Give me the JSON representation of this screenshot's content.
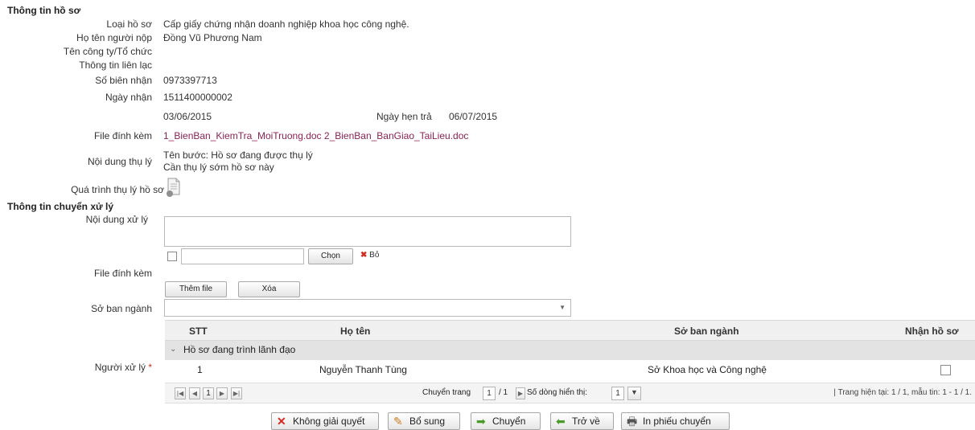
{
  "ho_so": {
    "section_title": "Thông tin hồ sơ",
    "loai_ho_so_label": "Loại hồ sơ",
    "loai_ho_so_value": "Cấp giấy chứng nhận doanh nghiệp khoa học công nghệ.",
    "ho_ten_label": "Họ tên người nộp",
    "ho_ten_value": "Đồng Vũ Phương Nam",
    "cong_ty_label": "Tên công ty/Tổ chức",
    "lien_lac_label": "Thông tin liên lạc",
    "lien_lac_value": "0973397713",
    "bien_nhan_label": "Số biên nhận",
    "bien_nhan_value": "1511400000002",
    "ngay_nhan_label": "Ngày nhận",
    "ngay_nhan_value": "03/06/2015",
    "ngay_hen_tra_label": "Ngày hẹn trả",
    "ngay_hen_tra_value": "06/07/2015",
    "file_label": "File đính kèm",
    "file_1": "1_BienBan_KiemTra_MoiTruong.doc",
    "file_2": "2_BienBan_BanGiao_TaiLieu.doc",
    "noi_dung_label": "Nội dung thụ lý",
    "noi_dung_line1": "Tên bước: Hồ sơ đang được thụ lý",
    "noi_dung_line2": "Cần thụ lý sớm hồ sơ này",
    "qua_trinh_label": "Quá trình thụ lý hồ sơ"
  },
  "chuyen_xu_ly": {
    "section_title": "Thông tin chuyển xử lý",
    "noi_dung_label": "Nội dung xử lý",
    "noi_dung_value": "",
    "file_label": "File đính kèm",
    "file_value": "",
    "chon_button": "Chọn",
    "bo_label": "Bỏ",
    "them_file_button": "Thêm file",
    "xoa_button": "Xóa",
    "so_ban_nganh_label": "Sở ban ngành",
    "so_ban_nganh_value": "",
    "nguoi_xu_ly_label": "Người xử lý",
    "required_mark": "*"
  },
  "grid": {
    "columns": [
      "STT",
      "Họ tên",
      "Sở ban ngành",
      "Nhận hồ sơ"
    ],
    "group_label": "Hồ sơ đang trình lãnh đạo",
    "rows": [
      {
        "stt": "1",
        "ho_ten": "Nguyễn Thanh Tùng",
        "so_ban_nganh": "Sở Khoa học và Công nghệ",
        "nhan_ho_so": false
      }
    ],
    "pager": {
      "current_page": "1",
      "chuyen_trang_label": "Chuyển trang",
      "page_input": "1",
      "total_pages": "/ 1",
      "so_dong_label": "Số dòng hiển thị:",
      "so_dong_value": "1",
      "status": "| Trang hiện tại: 1 / 1, mẫu tin: 1 - 1 / 1."
    }
  },
  "actions": {
    "khong_giai_quyet": "Không giải quyết",
    "bo_sung": "Bổ sung",
    "chuyen": "Chuyển",
    "tro_ve": "Trở về",
    "in_phieu": "In phiếu chuyển"
  },
  "colors": {
    "link": "#8b2252",
    "danger_icon": "#d42b1e",
    "arrow_icon": "#4a9a2a"
  }
}
